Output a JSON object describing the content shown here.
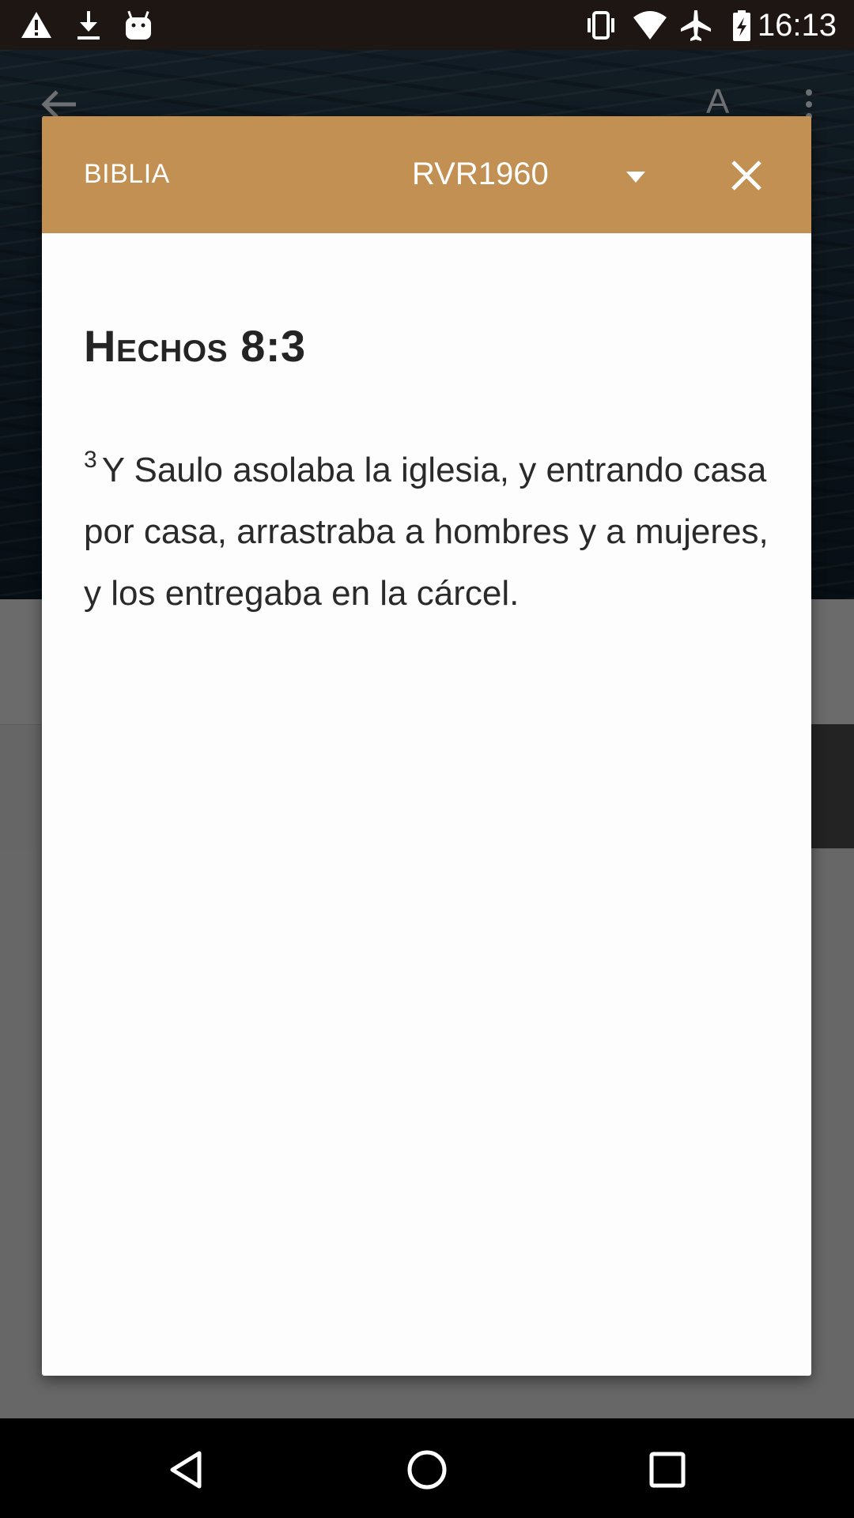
{
  "status_bar": {
    "time": "16:13",
    "left_icons": [
      "warning-icon",
      "download-icon",
      "android-icon"
    ],
    "right_icons": [
      "vibrate-icon",
      "wifi-icon",
      "airplane-mode-icon",
      "battery-charging-icon"
    ]
  },
  "background_app": {
    "toolbar": {
      "font_label": "A"
    }
  },
  "dialog": {
    "header": {
      "title": "BIBLIA",
      "version": "RVR1960"
    },
    "reference": "Hechos 8:3",
    "verse": {
      "number": "3",
      "text": "Y Saulo asolaba la iglesia, y entrando casa por casa, arrastraba a hombres y a mujeres, y los entregaba en la cárcel."
    }
  },
  "colors": {
    "header_bg": "#c19052",
    "dialog_bg": "#fdfdfd",
    "status_bar_bg": "#1e1613",
    "nav_bar_bg": "#000000"
  },
  "nav_bar": {
    "buttons": [
      "back-triangle-icon",
      "home-circle-icon",
      "recents-square-icon"
    ]
  }
}
